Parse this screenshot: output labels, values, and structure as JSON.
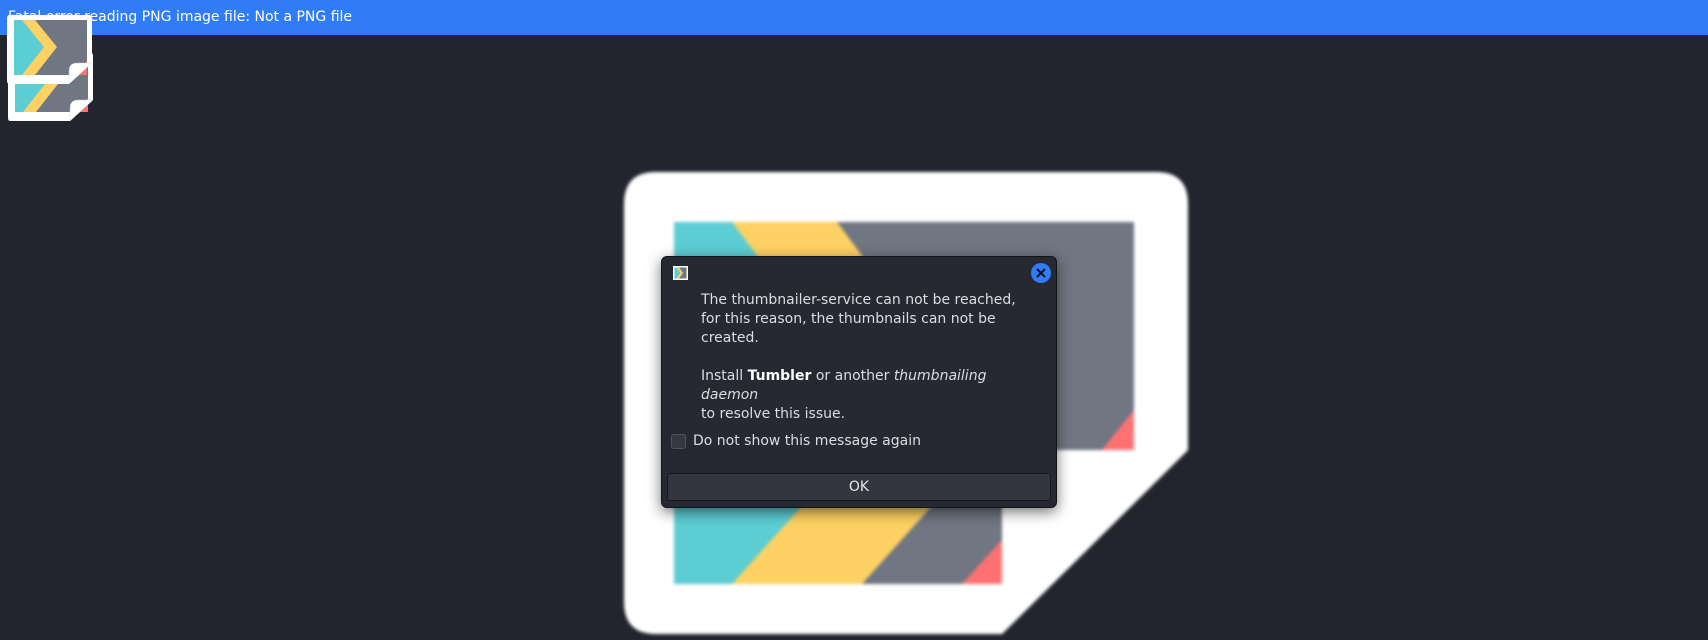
{
  "window": {
    "title": "Fatal error reading PNG image file: Not a PNG file"
  },
  "thumbnails": [
    {
      "name": "thumbnail-1",
      "selected": false
    },
    {
      "name": "thumbnail-2",
      "selected": true
    }
  ],
  "dialog": {
    "line1": "The thumbnailer-service can not be reached,",
    "line2": "for this reason, the thumbnails can not be",
    "line3": "created.",
    "install_prefix": "Install ",
    "install_bold": "Tumbler",
    "install_mid": " or another ",
    "install_italic": "thumbnailing daemon",
    "install_suffix": "to resolve this issue.",
    "checkbox_label": "Do not show this message again",
    "checkbox_checked": false,
    "ok_label": "OK"
  },
  "colors": {
    "accent": "#2f7cf6",
    "background": "#22252e",
    "teal": "#5ccdd3",
    "yellow": "#fdd163",
    "gray": "#707682",
    "coral": "#ff7171"
  }
}
